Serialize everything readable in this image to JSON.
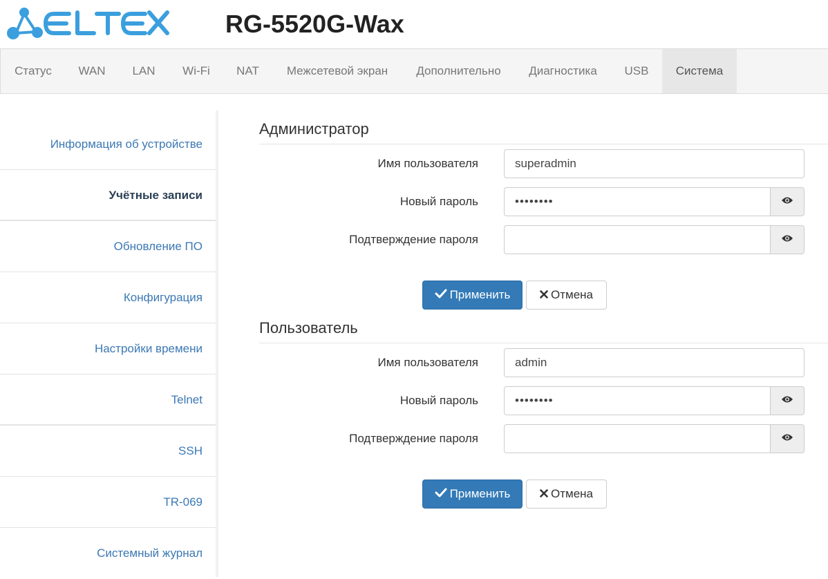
{
  "header": {
    "brand": "ELTEX",
    "model": "RG-5520G-Wax"
  },
  "nav": {
    "items": [
      {
        "label": "Статус"
      },
      {
        "label": "WAN"
      },
      {
        "label": "LAN"
      },
      {
        "label": "Wi-Fi"
      },
      {
        "label": "NAT"
      },
      {
        "label": "Межсетевой экран"
      },
      {
        "label": "Дополнительно"
      },
      {
        "label": "Диагностика"
      },
      {
        "label": "USB"
      },
      {
        "label": "Система"
      }
    ],
    "active": "Система"
  },
  "sidebar": {
    "items": [
      {
        "label": "Информация об устройстве"
      },
      {
        "label": "Учётные записи"
      },
      {
        "label": "Обновление ПО"
      },
      {
        "label": "Конфигурация"
      },
      {
        "label": "Настройки времени"
      },
      {
        "label": "Telnet"
      },
      {
        "label": "SSH"
      },
      {
        "label": "TR-069"
      },
      {
        "label": "Системный журнал"
      }
    ],
    "active": "Учётные записи"
  },
  "admin": {
    "title": "Администратор",
    "username_label": "Имя пользователя",
    "username_value": "superadmin",
    "new_password_label": "Новый пароль",
    "new_password_value": "password",
    "confirm_label": "Подтверждение пароля",
    "confirm_value": "",
    "apply_label": "Применить",
    "cancel_label": "Отмена"
  },
  "user": {
    "title": "Пользователь",
    "username_label": "Имя пользователя",
    "username_value": "admin",
    "new_password_label": "Новый пароль",
    "new_password_value": "password",
    "confirm_label": "Подтверждение пароля",
    "confirm_value": "",
    "apply_label": "Применить",
    "cancel_label": "Отмена"
  },
  "icons": {
    "logo": "eltex-logo",
    "show_password": "eye-icon",
    "apply": "check-icon",
    "cancel": "close-icon"
  },
  "colors": {
    "brand": "#3b9fde",
    "primary": "#337ab7",
    "link": "#3b78b4"
  }
}
